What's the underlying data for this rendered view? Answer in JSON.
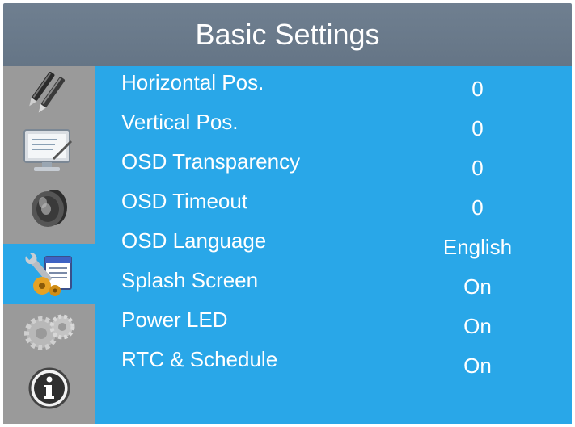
{
  "title": "Basic Settings",
  "sidebar": {
    "items": [
      {
        "icon": "pens-icon",
        "active": false
      },
      {
        "icon": "monitor-icon",
        "active": false
      },
      {
        "icon": "speaker-icon",
        "active": false
      },
      {
        "icon": "tools-icon",
        "active": true
      },
      {
        "icon": "gears-icon",
        "active": false
      },
      {
        "icon": "info-icon",
        "active": false
      }
    ]
  },
  "settings": [
    {
      "label": "Horizontal Pos.",
      "value": "0"
    },
    {
      "label": "Vertical Pos.",
      "value": "0"
    },
    {
      "label": "OSD Transparency",
      "value": "0"
    },
    {
      "label": "OSD Timeout",
      "value": "0"
    },
    {
      "label": "OSD Language",
      "value": "English"
    },
    {
      "label": "Splash Screen",
      "value": "On"
    },
    {
      "label": "Power LED",
      "value": "On"
    },
    {
      "label": "RTC & Schedule",
      "value": "On"
    }
  ],
  "colors": {
    "title_bar": "#6a7a8b",
    "sidebar": "#9a9a9a",
    "panel": "#29a7e8",
    "text": "#ffffff"
  }
}
